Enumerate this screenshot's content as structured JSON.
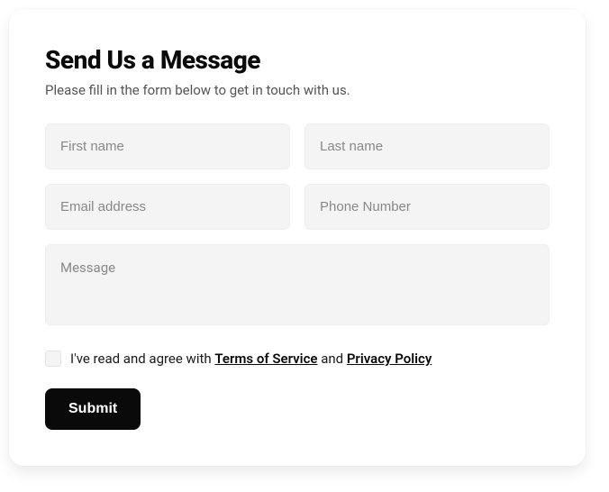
{
  "form": {
    "title": "Send Us a Message",
    "subtitle": "Please fill in the form below to get in touch with us.",
    "fields": {
      "first_name": {
        "placeholder": "First name",
        "value": ""
      },
      "last_name": {
        "placeholder": "Last name",
        "value": ""
      },
      "email": {
        "placeholder": "Email address",
        "value": ""
      },
      "phone": {
        "placeholder": "Phone Number",
        "value": ""
      },
      "message": {
        "placeholder": "Message",
        "value": ""
      }
    },
    "consent": {
      "checked": false,
      "prefix": "I've read and agree with ",
      "terms_label": "Terms of Service",
      "mid": " and ",
      "privacy_label": "Privacy Policy"
    },
    "submit_label": "Submit"
  }
}
